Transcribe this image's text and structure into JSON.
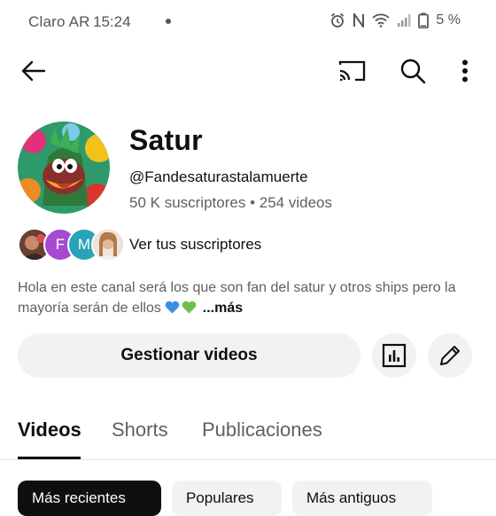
{
  "status_bar": {
    "carrier": "Claro AR",
    "time": "15:24",
    "battery": "5 %",
    "icons": [
      "alarm-icon",
      "nfc-icon",
      "wifi-icon",
      "signal-icon",
      "battery-icon"
    ]
  },
  "topbar": {
    "icons": [
      "back-arrow-icon",
      "cast-icon",
      "search-icon",
      "more-vert-icon"
    ]
  },
  "channel": {
    "name": "Satur",
    "handle": "@Fandesaturastalamuerte",
    "subscribers": "50 K suscriptores",
    "separator": "•",
    "videos": "254 videos",
    "description_text": "Hola en este canal será los que son fan del satur y otros ships pero la mayoría serán de ellos",
    "more_label": "...más",
    "heart_colors": [
      "#3b8fe0",
      "#6cc04a"
    ]
  },
  "subscribers_row": {
    "label": "Ver tus suscriptores",
    "avatars": [
      {
        "letter": "",
        "color": "#7a4a3a"
      },
      {
        "letter": "F",
        "color": "#a64bd1"
      },
      {
        "letter": "M",
        "color": "#2aa3b8"
      },
      {
        "letter": "",
        "color": "#e8c8b8"
      }
    ]
  },
  "actions": {
    "manage_label": "Gestionar videos",
    "icons": [
      "analytics-icon",
      "edit-pencil-icon"
    ]
  },
  "tabs": [
    {
      "label": "Videos",
      "active": true
    },
    {
      "label": "Shorts",
      "active": false
    },
    {
      "label": "Publicaciones",
      "active": false
    }
  ],
  "chips": [
    {
      "label": "Más recientes",
      "selected": true
    },
    {
      "label": "Populares",
      "selected": false
    },
    {
      "label": "Más antiguos",
      "selected": false
    }
  ],
  "colors": {
    "text_primary": "#0f0f0f",
    "text_secondary": "#606060",
    "chip_bg": "#f2f2f2"
  }
}
